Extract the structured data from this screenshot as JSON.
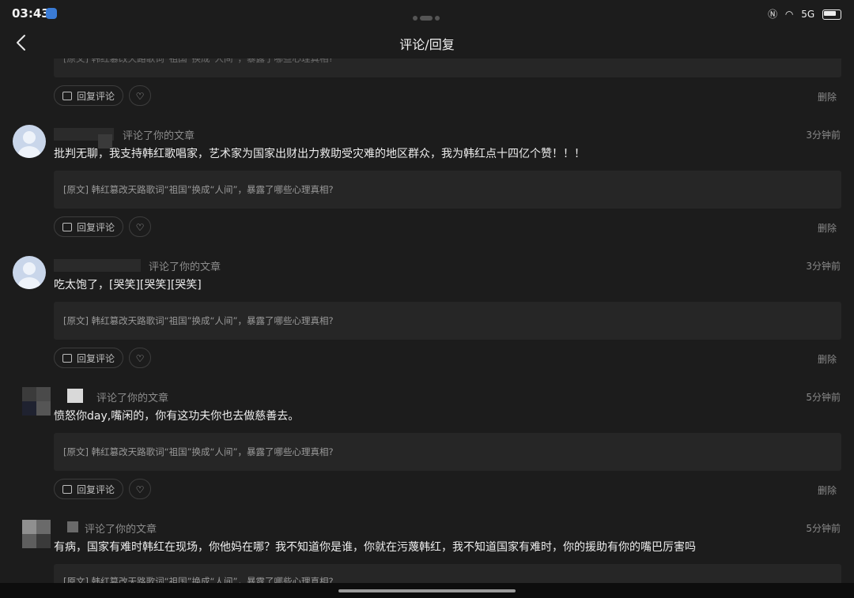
{
  "status_bar": {
    "time": "03:43",
    "signal_text": "5G"
  },
  "header": {
    "title": "评论/回复"
  },
  "top_partial": {
    "quote": "[原文] 韩红篡改天路歌词“祖国”换成“人间”，暴露了哪些心理真相?",
    "reply_label": "回复评论",
    "delete_label": "删除"
  },
  "comments": [
    {
      "user": "",
      "action": "评论了你的文章",
      "time": "3分钟前",
      "text": "批判无聊，我支持韩红歌唱家，艺术家为国家出财出力救助受灾难的地区群众，我为韩红点十四亿个赞！！！",
      "quote": "[原文] 韩红篡改天路歌词“祖国”换成“人间”，暴露了哪些心理真相?",
      "reply_label": "回复评论",
      "delete_label": "删除"
    },
    {
      "user": "",
      "action": "评论了你的文章",
      "time": "3分钟前",
      "text": "吃太饱了，[哭笑][哭笑][哭笑]",
      "quote": "[原文] 韩红篡改天路歌词“祖国”换成“人间”，暴露了哪些心理真相?",
      "reply_label": "回复评论",
      "delete_label": "删除"
    },
    {
      "user": "",
      "action": "评论了你的文章",
      "time": "5分钟前",
      "text": "愤怒你day,嘴闲的，你有这功夫你也去做慈善去。",
      "quote": "[原文] 韩红篡改天路歌词“祖国”换成“人间”，暴露了哪些心理真相?",
      "reply_label": "回复评论",
      "delete_label": "删除"
    },
    {
      "user": "",
      "action": "评论了你的文章",
      "time": "5分钟前",
      "text": "有病，国家有难时韩红在现场，你他妈在哪？我不知道你是谁，你就在污蔑韩红，我不知道国家有难时，你的援助有你的嘴巴厉害吗",
      "quote": "[原文] 韩红篡改天路歌词“祖国”换成“人间”，暴露了哪些心理真相?"
    }
  ],
  "icons": {
    "back": "chevron-left-icon",
    "reply": "comment-icon",
    "like": "heart-icon",
    "avatar": "user-avatar-icon"
  }
}
